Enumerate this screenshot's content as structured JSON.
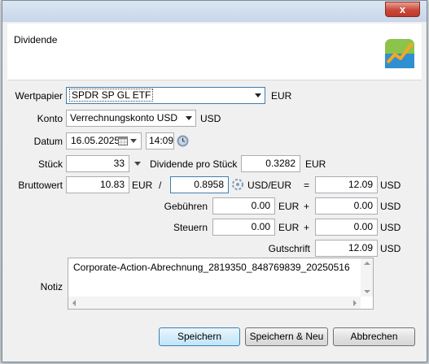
{
  "window": {
    "close_label": "x"
  },
  "header": {
    "title": "Dividende",
    "logo_icon": "app-logo-icon"
  },
  "form": {
    "security_label": "Wertpapier",
    "security_value": "SPDR SP GL ETF",
    "security_currency": "EUR",
    "account_label": "Konto",
    "account_value": "Verrechnungskonto USD",
    "account_currency": "USD",
    "date_label": "Datum",
    "date_value": "16.05.2025",
    "time_value": "14:09",
    "shares_label": "Stück",
    "shares_value": "33",
    "dividend_per_share_label": "Dividende pro Stück",
    "dividend_per_share_value": "0.3282",
    "dividend_per_share_currency": "EUR",
    "gross_label": "Bruttowert",
    "gross_value": "10.83",
    "gross_currency": "EUR",
    "divide_sign": "/",
    "exchange_rate_value": "0.8958",
    "exchange_rate_unit": "USD/EUR",
    "equals_sign": "=",
    "converted_value": "12.09",
    "converted_currency": "USD",
    "fees_label": "Gebühren",
    "fees_value": "0.00",
    "fees_currency": "EUR",
    "fees_plus": "+",
    "fees_converted_value": "0.00",
    "fees_converted_currency": "USD",
    "taxes_label": "Steuern",
    "taxes_value": "0.00",
    "taxes_currency": "EUR",
    "taxes_plus": "+",
    "taxes_converted_value": "0.00",
    "taxes_converted_currency": "USD",
    "credit_label": "Gutschrift",
    "credit_value": "12.09",
    "credit_currency": "USD",
    "note_label": "Notiz",
    "note_value": "Corporate-Action-Abrechnung_2819350_848769839_20250516"
  },
  "buttons": {
    "save": "Speichern",
    "save_new": "Speichern & Neu",
    "cancel": "Abbrechen"
  },
  "colors": {
    "accent": "#3c7fb1",
    "close": "#c0392b"
  }
}
